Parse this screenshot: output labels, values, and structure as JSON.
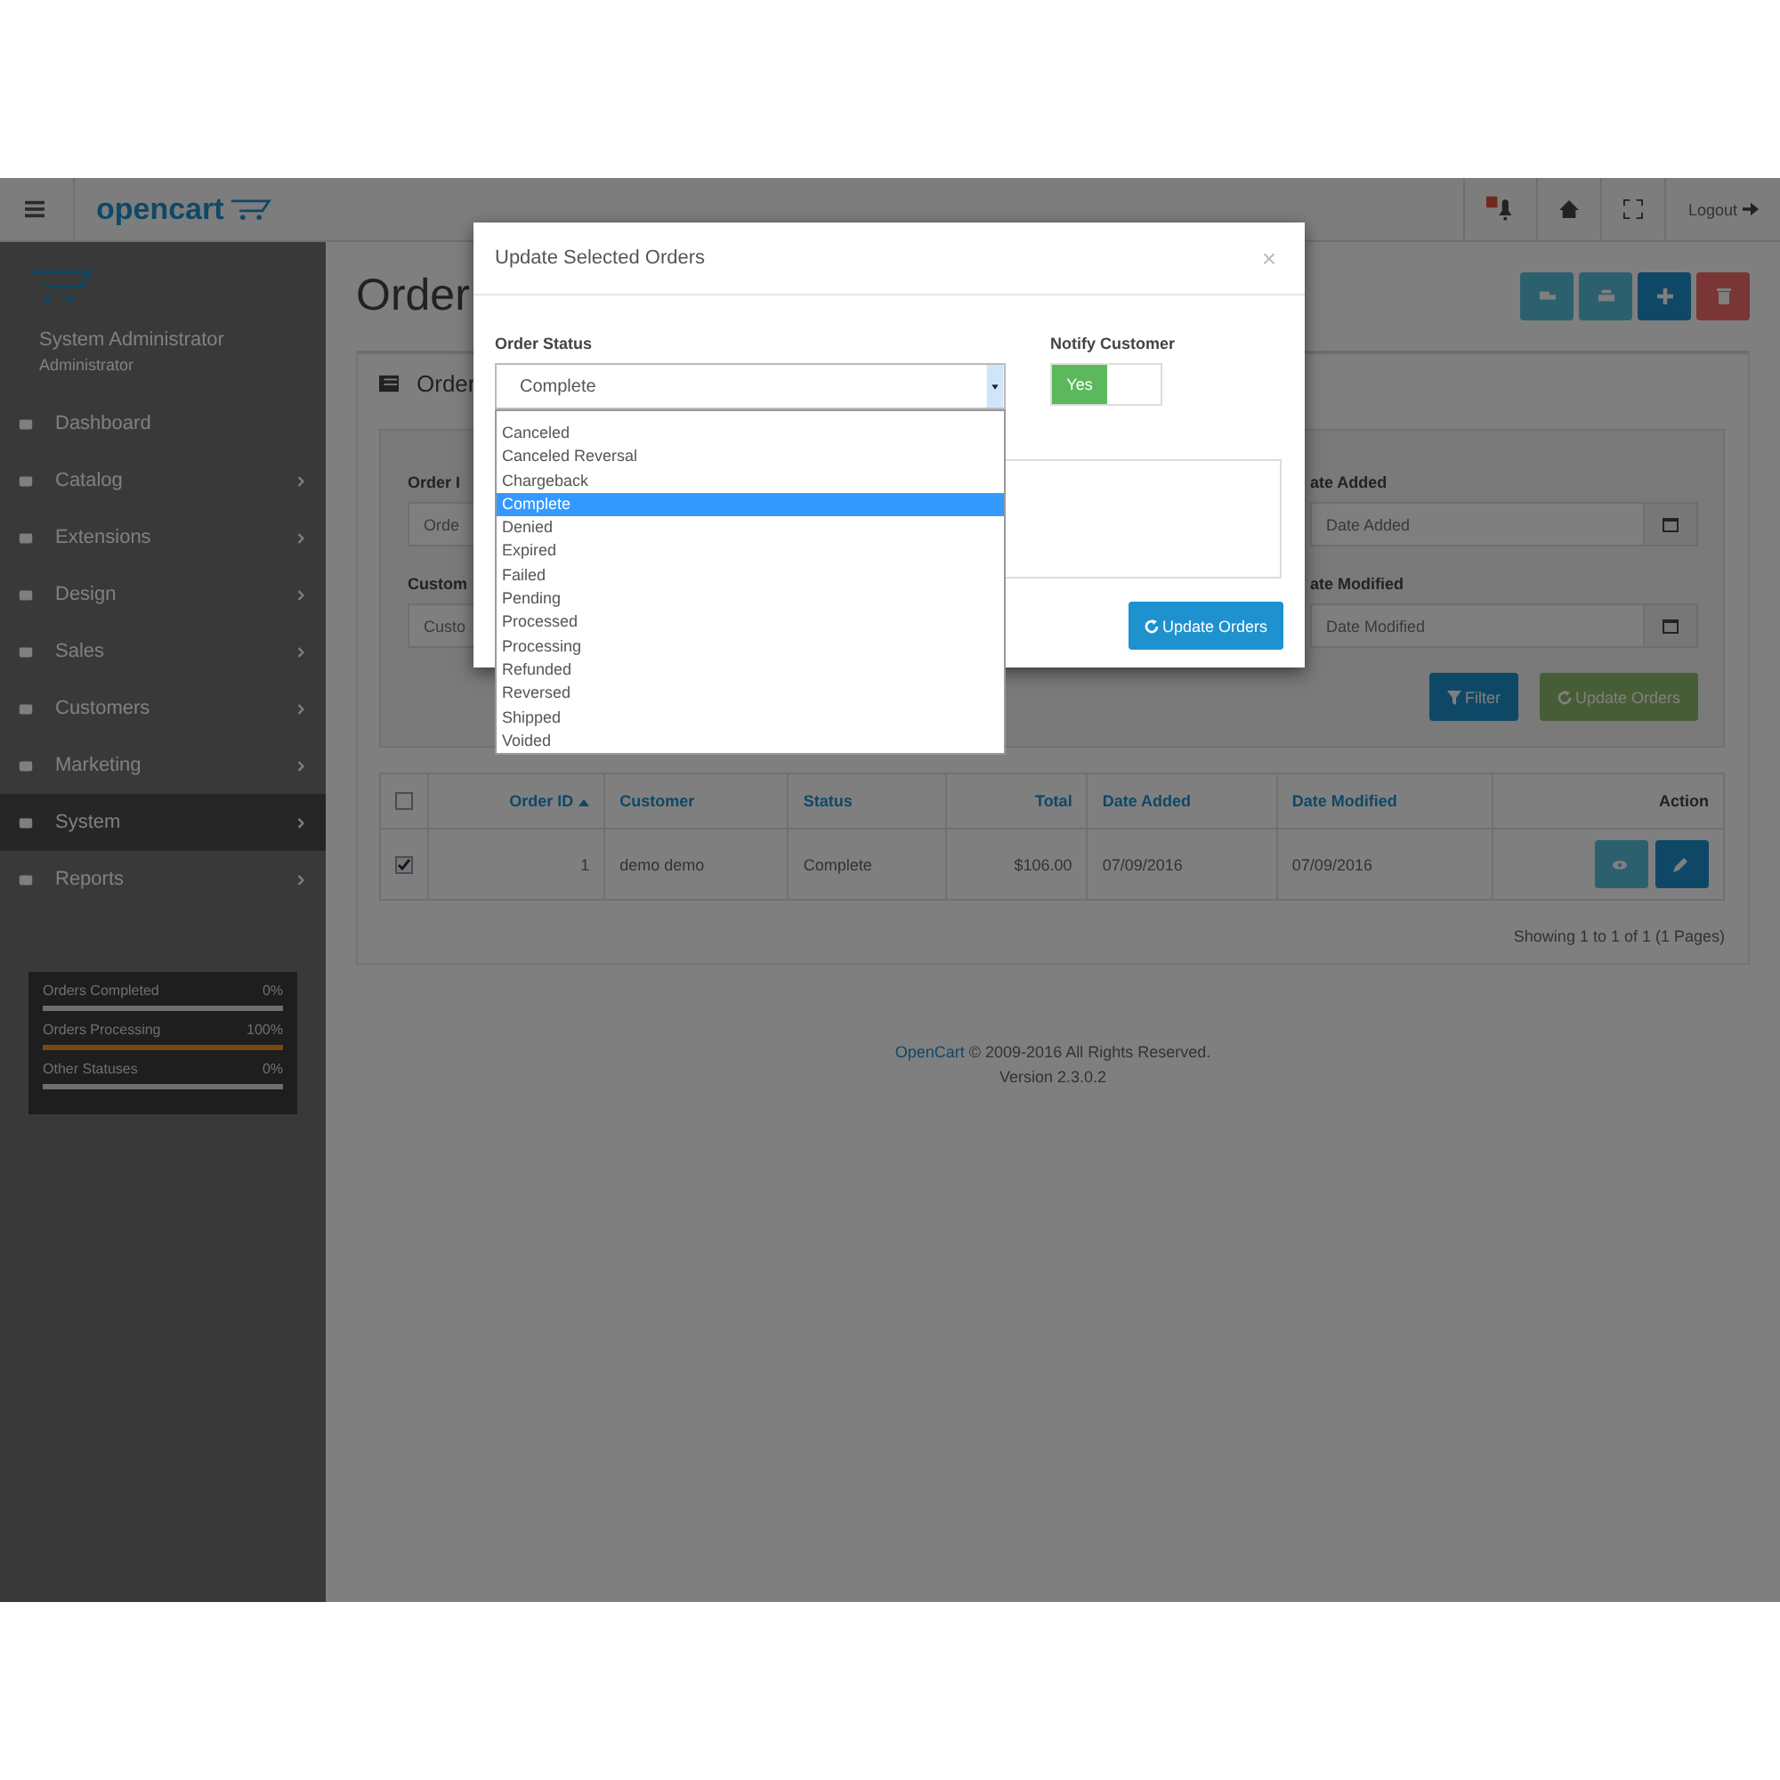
{
  "header": {
    "logo": "opencart",
    "logout": "Logout"
  },
  "sidebar": {
    "user_name": "System Administrator",
    "user_role": "Administrator",
    "menu": [
      {
        "label": "Dashboard",
        "selected": false,
        "has_submenu": false
      },
      {
        "label": "Catalog",
        "selected": false,
        "has_submenu": true
      },
      {
        "label": "Extensions",
        "selected": false,
        "has_submenu": true
      },
      {
        "label": "Design",
        "selected": false,
        "has_submenu": true
      },
      {
        "label": "Sales",
        "selected": false,
        "has_submenu": true
      },
      {
        "label": "Customers",
        "selected": false,
        "has_submenu": true
      },
      {
        "label": "Marketing",
        "selected": false,
        "has_submenu": true
      },
      {
        "label": "System",
        "selected": true,
        "has_submenu": true
      },
      {
        "label": "Reports",
        "selected": false,
        "has_submenu": true
      }
    ],
    "stats": [
      {
        "label": "Orders Completed",
        "value": "0%",
        "level": 0
      },
      {
        "label": "Orders Processing",
        "value": "100%",
        "level": 1
      },
      {
        "label": "Other Statuses",
        "value": "0%",
        "level": 0
      }
    ]
  },
  "page": {
    "title": "Order",
    "panel_title": "Order",
    "filters": [
      {
        "label": "Order I",
        "placeholder": "Orde",
        "calendar": false
      },
      {
        "label": "ate Added",
        "placeholder": "Date Added",
        "calendar": true
      },
      {
        "label": "Custom",
        "placeholder": "Custo",
        "calendar": false
      },
      {
        "label": "ate Modified",
        "placeholder": "Date Modified",
        "calendar": true
      }
    ],
    "filter_button": "Filter",
    "update_button": "Update Orders",
    "table": {
      "columns": [
        {
          "label": "Order ID",
          "sorted": true
        },
        {
          "label": "Customer",
          "sorted": false
        },
        {
          "label": "Status",
          "sorted": false
        },
        {
          "label": "Total",
          "sorted": false
        },
        {
          "label": "Date Added",
          "sorted": false
        },
        {
          "label": "Date Modified",
          "sorted": false
        },
        {
          "label": "Action",
          "sorted": false
        }
      ],
      "header_checked": false,
      "rows": [
        {
          "checked": true,
          "cells": [
            "1",
            "demo demo",
            "Complete",
            "$106.00",
            "07/09/2016",
            "07/09/2016"
          ]
        }
      ]
    },
    "pagination": "Showing 1 to 1 of 1 (1 Pages)",
    "footer": {
      "link": "OpenCart",
      "text": "© 2009-2016 All Rights Reserved.",
      "version": "Version 2.3.0.2"
    }
  },
  "modal": {
    "title": "Update Selected Orders",
    "close": "×",
    "status_label": "Order Status",
    "status_value": "Complete",
    "options": [
      {
        "label": "Canceled",
        "selected": false
      },
      {
        "label": "Canceled Reversal",
        "selected": false
      },
      {
        "label": "Chargeback",
        "selected": false
      },
      {
        "label": "Complete",
        "selected": true
      },
      {
        "label": "Denied",
        "selected": false
      },
      {
        "label": "Expired",
        "selected": false
      },
      {
        "label": "Failed",
        "selected": false
      },
      {
        "label": "Pending",
        "selected": false
      },
      {
        "label": "Processed",
        "selected": false
      },
      {
        "label": "Processing",
        "selected": false
      },
      {
        "label": "Refunded",
        "selected": false
      },
      {
        "label": "Reversed",
        "selected": false
      },
      {
        "label": "Shipped",
        "selected": false
      },
      {
        "label": "Voided",
        "selected": false
      }
    ],
    "notify_label": "Notify Customer",
    "notify_on": true,
    "notify_text": "Yes",
    "submit": "Update Orders"
  }
}
